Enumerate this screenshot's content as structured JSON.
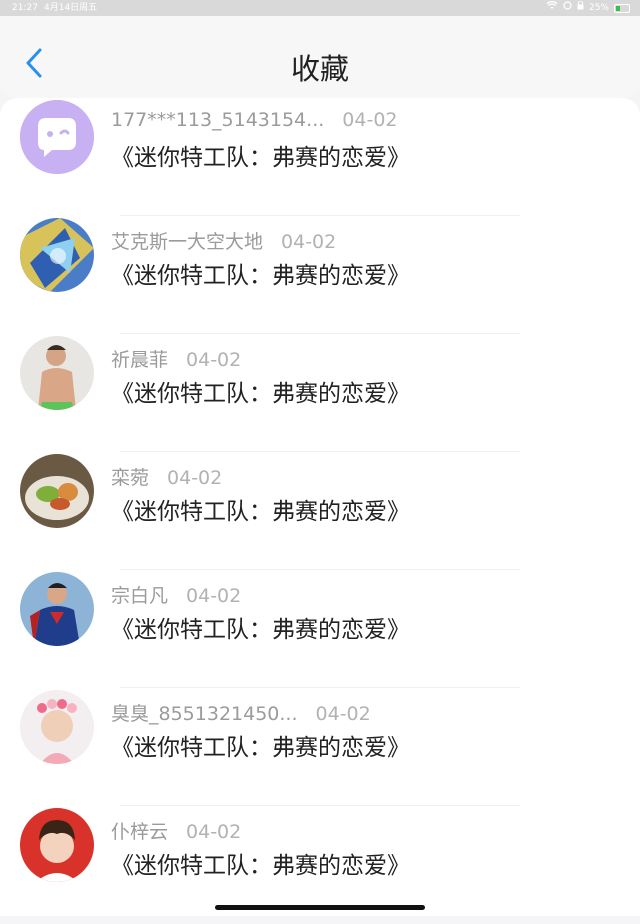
{
  "status": {
    "time": "21:27",
    "date": "4月14日周五",
    "battery": "25%"
  },
  "header": {
    "title": "收藏"
  },
  "items": [
    {
      "user": "177***113_5143154...",
      "date": "04-02",
      "title": "《迷你特工队：弗赛的恋爱》",
      "avatar": "avatar-chat-icon"
    },
    {
      "user": "艾克斯一大空大地",
      "date": "04-02",
      "title": "《迷你特工队：弗赛的恋爱》",
      "avatar": "avatar-anime-icon"
    },
    {
      "user": "祈晨菲",
      "date": "04-02",
      "title": "《迷你特工队：弗赛的恋爱》",
      "avatar": "avatar-person-icon"
    },
    {
      "user": "栾菀",
      "date": "04-02",
      "title": "《迷你特工队：弗赛的恋爱》",
      "avatar": "avatar-food-icon"
    },
    {
      "user": "宗白凡",
      "date": "04-02",
      "title": "《迷你特工队：弗赛的恋爱》",
      "avatar": "avatar-hero-icon"
    },
    {
      "user": "臭臭_8551321450...",
      "date": "04-02",
      "title": "《迷你特工队：弗赛的恋爱》",
      "avatar": "avatar-child-icon"
    },
    {
      "user": "仆梓云",
      "date": "04-02",
      "title": "《迷你特工队：弗赛的恋爱》",
      "avatar": "avatar-boy-icon"
    }
  ]
}
